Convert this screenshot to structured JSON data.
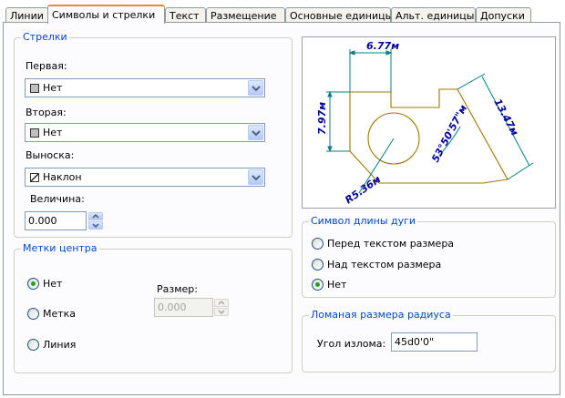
{
  "tabs": [
    {
      "label": "Линии",
      "active": false
    },
    {
      "label": "Символы и стрелки",
      "active": true
    },
    {
      "label": "Текст",
      "active": false
    },
    {
      "label": "Размещение",
      "active": false
    },
    {
      "label": "Основные единицы",
      "active": false
    },
    {
      "label": "Альт. единицы",
      "active": false
    },
    {
      "label": "Допуски",
      "active": false
    }
  ],
  "arrows": {
    "title": "Стрелки",
    "first_label": "Первая:",
    "first_value": "Нет",
    "second_label": "Вторая:",
    "second_value": "Нет",
    "leader_label": "Выноска:",
    "leader_value": "Наклон",
    "size_label": "Величина:",
    "size_value": "0.000"
  },
  "center_marks": {
    "title": "Метки центра",
    "options": [
      "Нет",
      "Метка",
      "Линия"
    ],
    "selected": "Нет",
    "size_label": "Размер:",
    "size_value": "0.000"
  },
  "arc_length_symbol": {
    "title": "Символ длины дуги",
    "options": [
      "Перед текстом размера",
      "Над текстом размера",
      "Нет"
    ],
    "selected": "Нет"
  },
  "radius_jog": {
    "title": "Ломаная размера радиуса",
    "angle_label": "Угол излома:",
    "angle_value": "45d0'0\""
  },
  "preview": {
    "dim_top": "6.77м",
    "dim_left": "7.97м",
    "dim_right": "13.47м",
    "dim_angle": "53°50'57\"м",
    "dim_radius": "R5.36м",
    "colors": {
      "dimension": "#008080",
      "geometry": "#a07800",
      "text": "#0000a0"
    }
  }
}
